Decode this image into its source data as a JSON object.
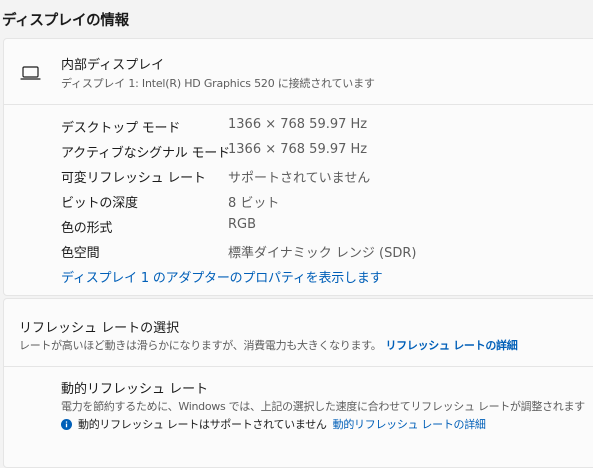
{
  "section": {
    "title": "ディスプレイの情報"
  },
  "display": {
    "icon": "laptop-icon",
    "name": "内部ディスプレイ",
    "subtitle": "ディスプレイ 1: Intel(R) HD Graphics 520 に接続されています",
    "details": [
      {
        "label": "デスクトップ モード",
        "value": "1366 × 768 59.97 Hz"
      },
      {
        "label": "アクティブなシグナル モード",
        "value": "1366 × 768 59.97 Hz"
      },
      {
        "label": "可変リフレッシュ レート",
        "value": "サポートされていません"
      },
      {
        "label": "ビットの深度",
        "value": "8 ビット"
      },
      {
        "label": "色の形式",
        "value": "RGB"
      },
      {
        "label": "色空間",
        "value": "標準ダイナミック レンジ (SDR)"
      }
    ],
    "adapter_link": "ディスプレイ 1 のアダプターのプロパティを表示します"
  },
  "refresh": {
    "title": "リフレッシュ レートの選択",
    "description": "レートが高いほど動きは滑らかになりますが、消費電力も大きくなります。",
    "details_link": "リフレッシュ レートの詳細",
    "dynamic": {
      "title": "動的リフレッシュ レート",
      "description": "電力を節約するために、Windows では、上記の選択した速度に合わせてリフレッシュ レートが調整されます",
      "note_icon": "info-icon",
      "note": "動的リフレッシュ レートはサポートされていません",
      "note_link": "動的リフレッシュ レートの詳細"
    }
  },
  "colors": {
    "accent": "#005fb8",
    "info": "#005fb8",
    "card": "#fbfbfb",
    "background": "#f3f3f3"
  }
}
